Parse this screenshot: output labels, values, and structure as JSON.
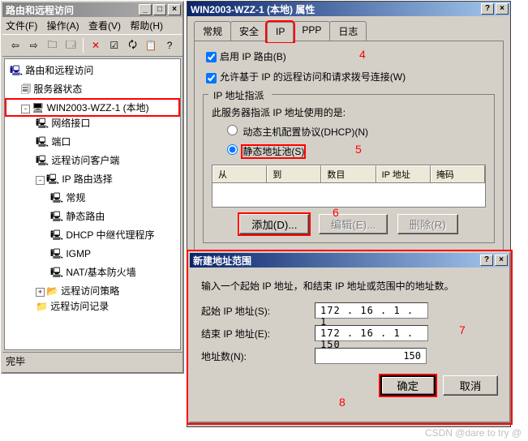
{
  "mmc": {
    "title": "路由和远程访问",
    "menu": {
      "file": "文件(F)",
      "action": "操作(A)",
      "view": "查看(V)",
      "help": "帮助(H)"
    },
    "status": "完毕",
    "tree": {
      "root": "路由和远程访问",
      "server_status": "服务器状态",
      "server": "WIN2003-WZZ-1 (本地)",
      "net_if": "网络接口",
      "ports": "端口",
      "ra_clients": "远程访问客户端",
      "ip_routing": "IP 路由选择",
      "general": "常规",
      "static_routes": "静态路由",
      "dhcp_relay": "DHCP 中继代理程序",
      "igmp": "IGMP",
      "nat": "NAT/基本防火墙",
      "ra_policies": "远程访问策略",
      "ra_logging": "远程访问记录"
    }
  },
  "props": {
    "title": "WIN2003-WZZ-1 (本地) 属性",
    "tabs": {
      "general": "常规",
      "security": "安全",
      "ip": "IP",
      "ppp": "PPP",
      "log": "日志"
    },
    "enable_ip_routing": "启用 IP 路由(B)",
    "allow_remote": "允许基于 IP 的远程访问和请求拨号连接(W)",
    "ip_assign_group": "IP 地址指派",
    "ip_assign_desc": "此服务器指派 IP 地址使用的是:",
    "dhcp_radio": "动态主机配置协议(DHCP)(N)",
    "static_radio": "静态地址池(S)",
    "cols": {
      "from": "从",
      "to": "到",
      "count": "数目",
      "ip": "IP 地址",
      "mask": "掩码"
    },
    "add_btn": "添加(D)...",
    "edit_btn": "编辑(E)...",
    "remove_btn": "删除(R)"
  },
  "newrange": {
    "title": "新建地址范围",
    "desc": "输入一个起始 IP 地址，和结束 IP 地址或范围中的地址数。",
    "start_label": "起始 IP 地址(S):",
    "end_label": "结束 IP 地址(E):",
    "count_label": "地址数(N):",
    "start_value": "172 . 16 .  1  .  1",
    "end_value": "172 . 16 .  1  . 150",
    "count_value": "150",
    "ok": "确定",
    "cancel": "取消"
  },
  "annotations": {
    "n4": "4",
    "n5": "5",
    "n6": "6",
    "n7": "7",
    "n8": "8"
  },
  "watermark": "CSDN @dare to try @"
}
